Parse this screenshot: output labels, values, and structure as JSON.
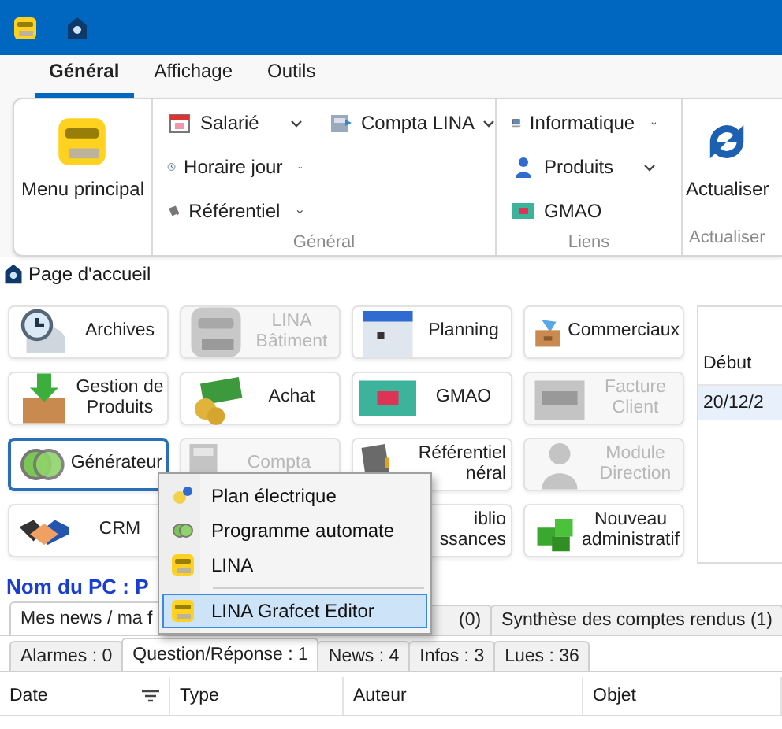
{
  "ribbon": {
    "tabs": [
      {
        "label": "Général",
        "selected": true
      },
      {
        "label": "Affichage",
        "selected": false
      },
      {
        "label": "Outils",
        "selected": false
      }
    ],
    "home_button": "Menu principal",
    "general_group": {
      "label": "Général",
      "column_1": [
        {
          "label": "Salarié",
          "dropdown": true
        },
        {
          "label": "Horaire jour",
          "dropdown": true
        },
        {
          "label": "Référentiel",
          "dropdown": true
        }
      ],
      "column_2": [
        {
          "label": "Compta LINA",
          "dropdown": true
        }
      ]
    },
    "links_group": {
      "label": "Liens",
      "items": [
        {
          "label": "Informatique",
          "dropdown": true
        },
        {
          "label": "Produits",
          "dropdown": true
        },
        {
          "label": "GMAO",
          "dropdown": false
        }
      ]
    },
    "refresh_group": {
      "label": "Actualiser",
      "button": "Actualiser"
    }
  },
  "breadcrumb": "Page d'accueil",
  "tiles": [
    {
      "kind": "tile",
      "lines": [
        "Archives"
      ],
      "disabled": false,
      "selected": false
    },
    {
      "kind": "tile",
      "lines": [
        "LINA",
        "Bâtiment"
      ],
      "disabled": true,
      "selected": false
    },
    {
      "kind": "tile",
      "lines": [
        "Planning"
      ],
      "disabled": false,
      "selected": false
    },
    {
      "kind": "tile",
      "lines": [
        "Commerciaux"
      ],
      "disabled": false,
      "selected": false
    },
    {
      "kind": "tile",
      "lines": [
        "Gestion de",
        "Produits"
      ],
      "disabled": false,
      "selected": false
    },
    {
      "kind": "tile",
      "lines": [
        "Achat"
      ],
      "disabled": false,
      "selected": false
    },
    {
      "kind": "tile",
      "lines": [
        "GMAO"
      ],
      "disabled": false,
      "selected": false
    },
    {
      "kind": "tile",
      "lines": [
        "Facture",
        "Client"
      ],
      "disabled": true,
      "selected": false
    },
    {
      "kind": "tile",
      "lines": [
        "Générateur"
      ],
      "disabled": false,
      "selected": true
    },
    {
      "kind": "tile",
      "lines": [
        "Compta"
      ],
      "disabled": true,
      "selected": false
    },
    {
      "kind": "tile",
      "lines": [
        "Référentiel",
        "néral"
      ],
      "disabled": false,
      "selected": false
    },
    {
      "kind": "tile",
      "lines": [
        "Module",
        "Direction"
      ],
      "disabled": true,
      "selected": false
    },
    {
      "kind": "tile",
      "lines": [
        "CRM"
      ],
      "disabled": false,
      "selected": false
    },
    {
      "kind": "covered"
    },
    {
      "kind": "tile",
      "lines": [
        "iblio",
        "ssances"
      ],
      "disabled": false,
      "selected": false
    },
    {
      "kind": "tile",
      "lines": [
        "Nouveau",
        "administratif"
      ],
      "disabled": false,
      "selected": false
    }
  ],
  "side_table": {
    "columns": [
      "Début"
    ],
    "rows": [
      {
        "cells": [
          "20/12/2"
        ],
        "selected": true
      }
    ]
  },
  "context_menu": [
    {
      "kind": "item",
      "label": "Plan électrique",
      "selected": false
    },
    {
      "kind": "item",
      "label": "Programme automate",
      "selected": false
    },
    {
      "kind": "item",
      "label": "LINA",
      "selected": false
    },
    {
      "kind": "separator"
    },
    {
      "kind": "item",
      "label": "LINA Grafcet Editor",
      "selected": true
    }
  ],
  "pc_name": "Nom du PC : P",
  "news_tabs": [
    {
      "label": "Mes news / ma f",
      "selected": true
    },
    {
      "label": "(0)",
      "selected": false
    },
    {
      "label": "Synthèse des comptes rendus (1)",
      "selected": false
    }
  ],
  "filter_tabs": [
    {
      "label": "Alarmes : 0",
      "selected": false
    },
    {
      "label": "Question/Réponse : 1",
      "selected": true
    },
    {
      "label": "News : 4",
      "selected": false
    },
    {
      "label": "Infos : 3",
      "selected": false
    },
    {
      "label": "Lues : 36",
      "selected": false
    }
  ],
  "table": {
    "columns": [
      "Date",
      "Type",
      "Auteur",
      "Objet"
    ]
  }
}
